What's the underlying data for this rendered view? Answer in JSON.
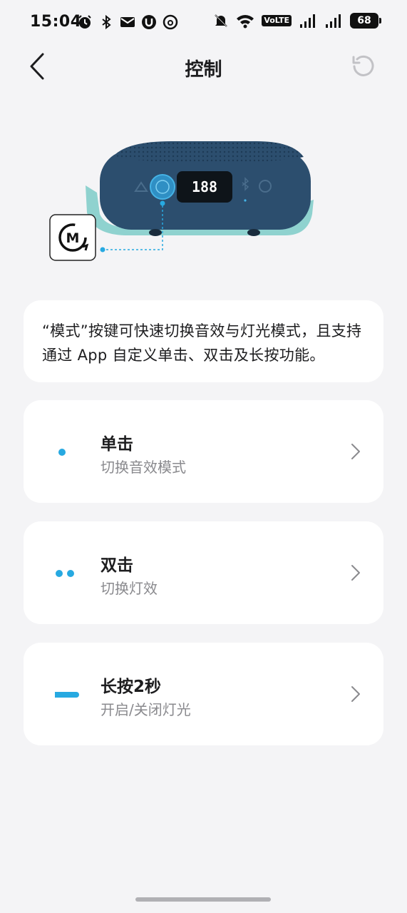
{
  "status_bar": {
    "time": "15:04",
    "volte_label": "VoLTE",
    "battery": "68"
  },
  "header": {
    "title": "控制",
    "back_icon": "chevron-left-icon",
    "reset_icon": "refresh-icon"
  },
  "product": {
    "display_text": "188",
    "mode_badge": "M"
  },
  "description": "“模式”按键可快速切换音效与灯光模式，且支持通过 App 自定义单击、双击及长按功能。",
  "options": [
    {
      "title": "单击",
      "subtitle": "切换音效模式",
      "indicator": "single-dot"
    },
    {
      "title": "双击",
      "subtitle": "切换灯效",
      "indicator": "double-dot"
    },
    {
      "title": "长按2秒",
      "subtitle": "开启/关闭灯光",
      "indicator": "long-bar"
    }
  ],
  "colors": {
    "accent": "#27a9e1",
    "background": "#f4f4f6",
    "card": "#ffffff",
    "speaker_body": "#2c4e6e",
    "speaker_base": "#8fd2cf"
  }
}
